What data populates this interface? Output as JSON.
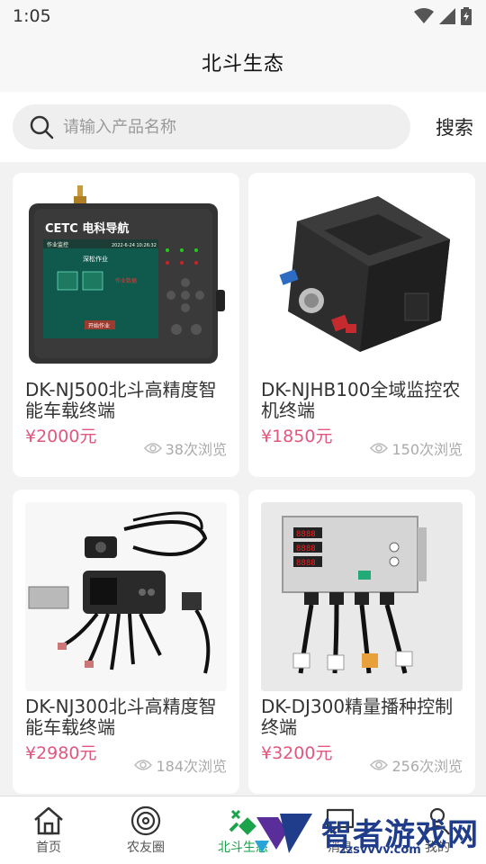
{
  "status": {
    "time": "1:05"
  },
  "header": {
    "title": "北斗生态"
  },
  "search": {
    "placeholder": "请输入产品名称",
    "button_label": "搜索"
  },
  "products": [
    {
      "name": "DK-NJ500北斗高精度智能车载终端",
      "price": "¥2000元",
      "views": "38次浏览"
    },
    {
      "name": "DK-NJHB100全域监控农机终端",
      "price": "¥1850元",
      "views": "150次浏览"
    },
    {
      "name": "DK-NJ300北斗高精度智能车载终端",
      "price": "¥2980元",
      "views": "184次浏览"
    },
    {
      "name": "DK-DJ300精量播种控制终端",
      "price": "¥3200元",
      "views": "256次浏览"
    }
  ],
  "device_screen": {
    "brand": "CETC 电科导航",
    "date": "2022-6-24 10:26:32",
    "panel_title": "作业监控",
    "mode": "深松作业",
    "start": "开始作业"
  },
  "tabs": [
    {
      "label": "首页",
      "icon": "home-icon"
    },
    {
      "label": "农友圈",
      "icon": "circle-icon"
    },
    {
      "label": "北斗生态",
      "icon": "beidou-icon",
      "active": true
    },
    {
      "label": "消息",
      "icon": "message-icon"
    },
    {
      "label": "我的",
      "icon": "user-icon"
    }
  ],
  "watermark": {
    "text": "智者游戏网",
    "url": "zzsvvvv.com"
  },
  "colors": {
    "price": "#e0577f",
    "active_tab": "#1aa34a",
    "watermark": "#1f3d8a"
  }
}
